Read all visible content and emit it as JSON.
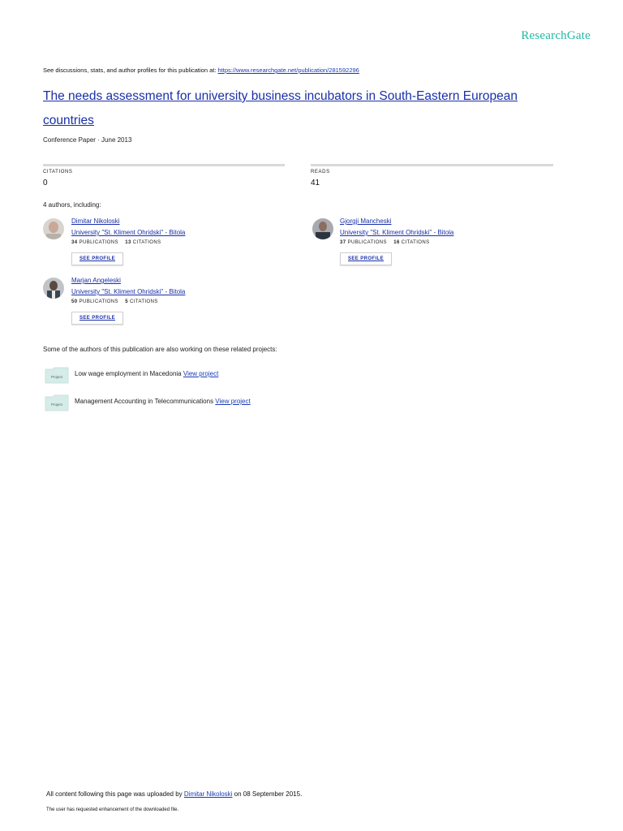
{
  "header": {
    "brand": "ResearchGate",
    "discussions_text": "See discussions, stats, and author profiles for this publication at: ",
    "discussions_url": "https://www.researchgate.net/publication/281592296"
  },
  "publication": {
    "title": "The needs assessment for university business incubators in South-Eastern European countries",
    "meta": "Conference Paper · June 2013"
  },
  "stats": {
    "citations_label": "CITATIONS",
    "citations_value": "0",
    "reads_label": "READS",
    "reads_value": "41"
  },
  "authors_heading": "4 authors, including:",
  "publications_label": "PUBLICATIONS",
  "citations_label": "CITATIONS",
  "see_profile_label": "SEE PROFILE",
  "authors": [
    {
      "name": "Dimitar Nikoloski",
      "affiliation": "University \"St. Kliment Ohridski\" - Bitola",
      "publications": "34",
      "citations": "13"
    },
    {
      "name": "Gjorgji Mancheski",
      "affiliation": "University \"St. Kliment Ohridski\" - Bitola",
      "publications": "37",
      "citations": "16"
    },
    {
      "name": "Marjan Angeleski",
      "affiliation": "University \"St. Kliment Ohridski\" - Bitola",
      "publications": "50",
      "citations": "5"
    }
  ],
  "projects_heading": "Some of the authors of this publication are also working on these related projects:",
  "project_icon_label": "Project",
  "view_project_label": "View project",
  "projects": [
    {
      "name": "Low wage employment in Macedonia"
    },
    {
      "name": "Management Accounting in Telecommunications"
    }
  ],
  "footer": {
    "uploaded_prefix": "All content following this page was uploaded by ",
    "uploader": "Dimitar Nikoloski",
    "uploaded_suffix": " on 08 September 2015.",
    "enhancement_note": "The user has requested enhancement of the downloaded file."
  }
}
